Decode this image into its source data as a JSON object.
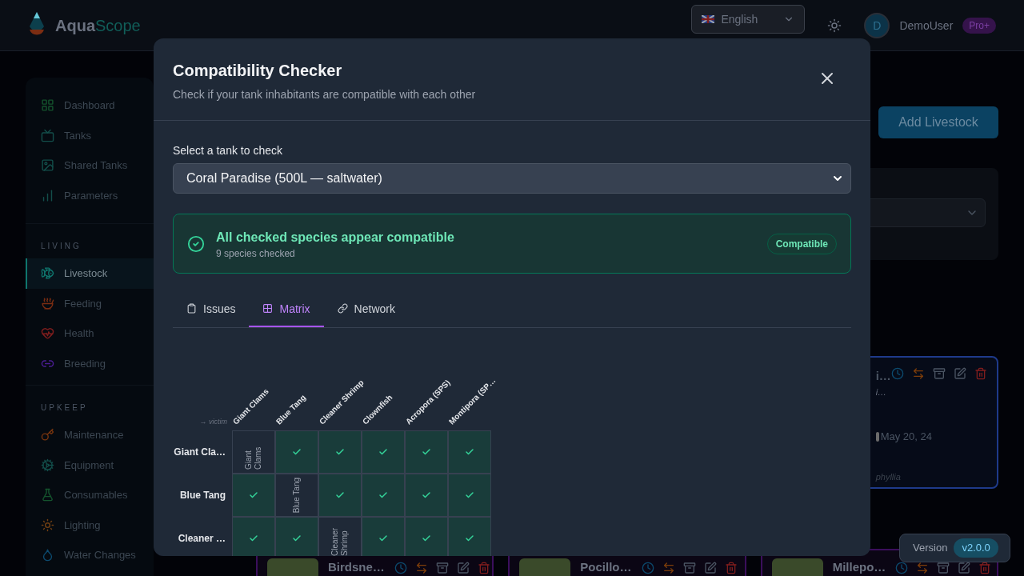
{
  "header": {
    "brand_primary": "Aqua",
    "brand_secondary": "Scope",
    "language": "English",
    "user": {
      "initial": "D",
      "name": "DemoUser",
      "plan": "Pro+"
    }
  },
  "sidebar": {
    "sections": [
      {
        "items": [
          {
            "label": "Dashboard",
            "selected": false
          },
          {
            "label": "Tanks",
            "selected": false
          },
          {
            "label": "Shared Tanks",
            "selected": false
          },
          {
            "label": "Parameters",
            "selected": false
          }
        ]
      },
      {
        "title": "LIVING",
        "items": [
          {
            "label": "Livestock",
            "selected": true
          },
          {
            "label": "Feeding",
            "selected": false
          },
          {
            "label": "Health",
            "selected": false
          },
          {
            "label": "Breeding",
            "selected": false
          }
        ]
      },
      {
        "title": "UPKEEP",
        "items": [
          {
            "label": "Maintenance",
            "selected": false
          },
          {
            "label": "Equipment",
            "selected": false
          },
          {
            "label": "Consumables",
            "selected": false
          },
          {
            "label": "Lighting",
            "selected": false
          },
          {
            "label": "Water Changes",
            "selected": false
          }
        ]
      }
    ]
  },
  "page": {
    "add_button": "Add Livestock",
    "featured_card": {
      "title": "i…",
      "subtitle": "i…",
      "date": "May 20, 24",
      "species": "phyllia"
    },
    "cards": [
      {
        "title": "Birdsne…"
      },
      {
        "title": "Pocillo…"
      },
      {
        "title": "Millepo…"
      }
    ]
  },
  "version": {
    "label": "Version",
    "value": "v2.0.0"
  },
  "dialog": {
    "title": "Compatibility Checker",
    "subtitle": "Check if your tank inhabitants are compatible with each other",
    "tank_label": "Select a tank to check",
    "tank_value": "Coral Paradise (500L — saltwater)",
    "result": {
      "compatible": true,
      "headline": "All checked species appear compatible",
      "detail": "9 species checked",
      "badge": "Compatible"
    },
    "tabs": [
      {
        "label": "Issues",
        "selected": false
      },
      {
        "label": "Matrix",
        "selected": true
      },
      {
        "label": "Network",
        "selected": false
      }
    ],
    "matrix": {
      "axis_label": "→ victim",
      "columns": [
        "Giant Clams",
        "Blue Tang",
        "Cleaner Shrimp",
        "Clownfish",
        "Acropora (SPS)",
        "Montipora (SP…"
      ],
      "rows": [
        {
          "label": "Giant Cla…",
          "cells": [
            {
              "kind": "self",
              "label": "Giant Clams"
            },
            {
              "kind": "ok"
            },
            {
              "kind": "ok"
            },
            {
              "kind": "ok"
            },
            {
              "kind": "ok"
            },
            {
              "kind": "ok"
            }
          ]
        },
        {
          "label": "Blue Tang",
          "cells": [
            {
              "kind": "ok"
            },
            {
              "kind": "self",
              "label": "Blue Tang"
            },
            {
              "kind": "ok"
            },
            {
              "kind": "ok"
            },
            {
              "kind": "ok"
            },
            {
              "kind": "ok"
            }
          ]
        },
        {
          "label": "Cleaner …",
          "cells": [
            {
              "kind": "ok"
            },
            {
              "kind": "ok"
            },
            {
              "kind": "self",
              "label": "Cleaner Shrimp"
            },
            {
              "kind": "ok"
            },
            {
              "kind": "ok"
            },
            {
              "kind": "ok"
            }
          ]
        }
      ]
    }
  }
}
